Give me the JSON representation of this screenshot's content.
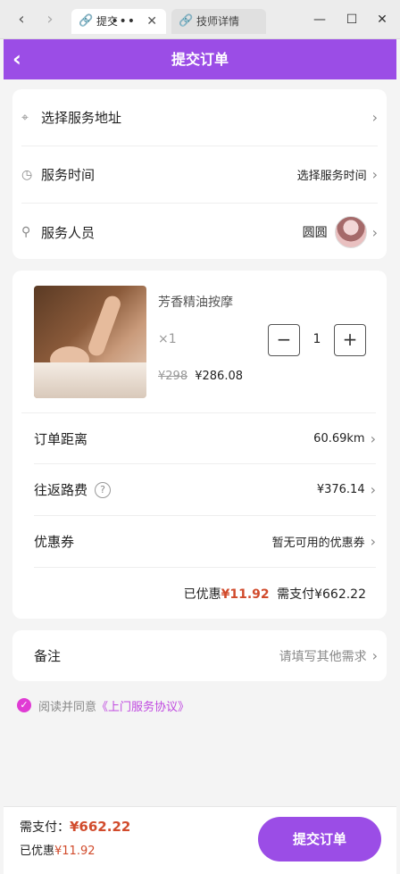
{
  "browser": {
    "tabs": [
      {
        "label": "提交"
      },
      {
        "label": "技师详情"
      }
    ]
  },
  "header": {
    "title": "提交订单"
  },
  "service": {
    "address_label": "选择服务地址",
    "time_label": "服务时间",
    "time_value": "选择服务时间",
    "staff_label": "服务人员",
    "staff_name": "圆圆"
  },
  "product": {
    "name": "芳香精油按摩",
    "count": "×1",
    "original_price": "¥298",
    "price": "¥286.08",
    "quantity": "1"
  },
  "order": {
    "distance_label": "订单距离",
    "distance_value": "60.69km",
    "fare_label": "往返路费",
    "fare_value": "¥376.14",
    "coupon_label": "优惠券",
    "coupon_value": "暂无可用的优惠券",
    "discount_prefix": "已优惠",
    "discount_amount": "¥11.92",
    "pay_text": "需支付¥662.22"
  },
  "remark": {
    "label": "备注",
    "placeholder": "请填写其他需求"
  },
  "agreement": {
    "prefix": "阅读并同意",
    "link": "《上门服务协议》"
  },
  "footer": {
    "pay_label": "需支付：",
    "pay_amount": "¥662.22",
    "discount_label": "已优惠",
    "discount_amount": "¥11.92",
    "submit_label": "提交订单"
  },
  "colors": {
    "brand": "#9b4de6",
    "price_red": "#d14b2c",
    "agree_pink": "#e03bd4"
  }
}
